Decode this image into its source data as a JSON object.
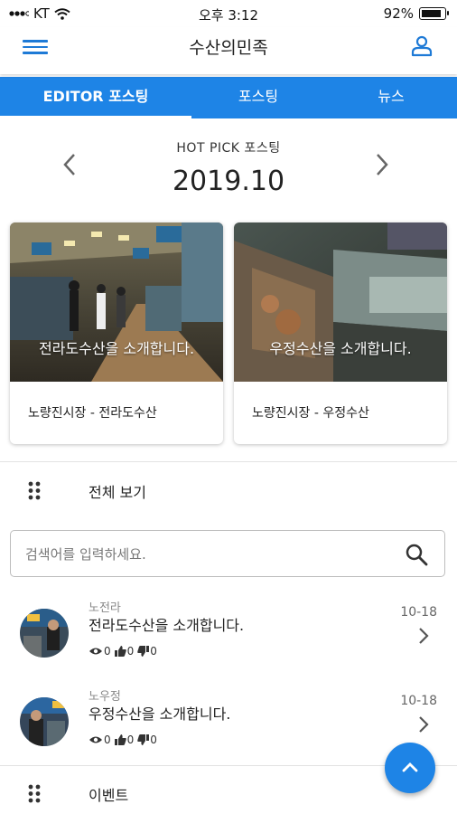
{
  "status": {
    "carrier": "KT",
    "time": "오후 3:12",
    "battery": "92%",
    "battery_level": 0.92
  },
  "header": {
    "title": "수산의민족"
  },
  "tabs": [
    {
      "label": "EDITOR 포스팅",
      "active": true
    },
    {
      "label": "포스팅",
      "active": false
    },
    {
      "label": "뉴스",
      "active": false
    }
  ],
  "hot_pick": {
    "label": "HOT PICK 포스팅",
    "date": "2019.10",
    "cards": [
      {
        "caption": "전라도수산을 소개합니다.",
        "subtitle": "노량진시장 - 전라도수산"
      },
      {
        "caption": "우정수산을 소개합니다.",
        "subtitle": "노량진시장 - 우정수산"
      }
    ]
  },
  "view_all": {
    "label": "전체 보기"
  },
  "search": {
    "placeholder": "검색어를 입력하세요."
  },
  "posts": [
    {
      "author": "노전라",
      "title": "전라도수산을 소개합니다.",
      "views": "0",
      "likes": "0",
      "dislikes": "0",
      "date": "10-18"
    },
    {
      "author": "노우정",
      "title": "우정수산을 소개합니다.",
      "views": "0",
      "likes": "0",
      "dislikes": "0",
      "date": "10-18"
    }
  ],
  "events": {
    "label": "이벤트"
  },
  "colors": {
    "accent": "#1e84e6",
    "icon_blue": "#1e7ad6"
  }
}
